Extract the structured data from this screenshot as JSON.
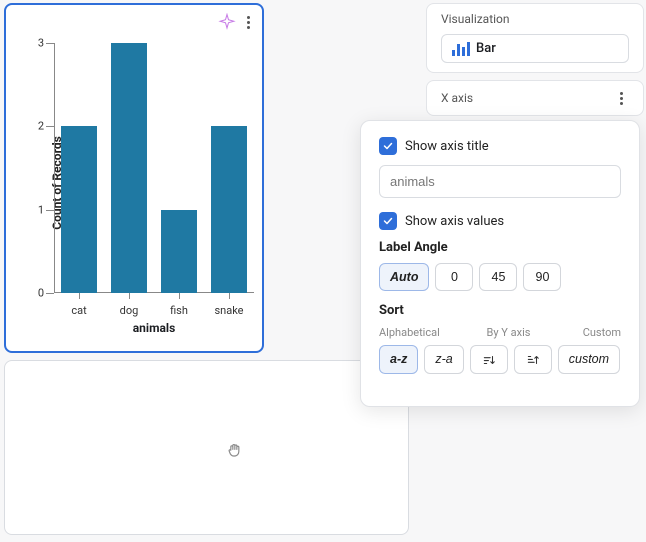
{
  "chart_data": {
    "type": "bar",
    "categories": [
      "cat",
      "dog",
      "fish",
      "snake"
    ],
    "values": [
      2,
      3,
      1,
      2
    ],
    "title": "",
    "xlabel": "animals",
    "ylabel": "Count of Records",
    "ylim": [
      0,
      3
    ],
    "yticks": [
      0,
      1,
      2,
      3
    ]
  },
  "sidebar": {
    "visualization": {
      "section_title": "Visualization",
      "type_label": "Bar"
    },
    "xaxis": {
      "section_title": "X axis"
    }
  },
  "popover": {
    "show_axis_title": {
      "label": "Show axis title",
      "checked": true,
      "input_value": "animals"
    },
    "show_axis_values": {
      "label": "Show axis values",
      "checked": true
    },
    "label_angle": {
      "title": "Label Angle",
      "options": [
        "Auto",
        "0",
        "45",
        "90"
      ],
      "selected": "Auto"
    },
    "sort": {
      "title": "Sort",
      "headers": [
        "Alphabetical",
        "By Y axis",
        "Custom"
      ],
      "options": {
        "az": "a-z",
        "za": "z-a",
        "custom": "custom"
      },
      "selected": "a-z"
    }
  }
}
